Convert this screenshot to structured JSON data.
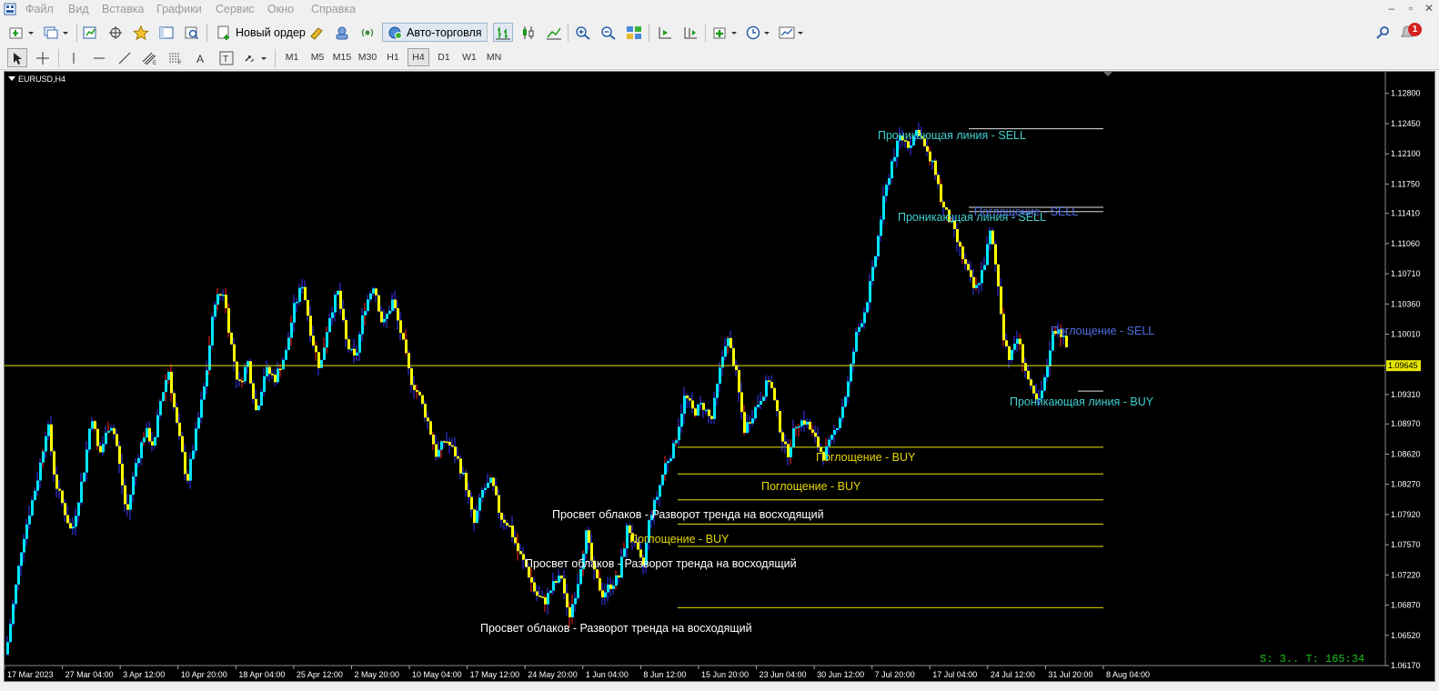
{
  "menu": {
    "items": [
      "Файл",
      "Вид",
      "Вставка",
      "Графики",
      "Сервис",
      "Окно",
      "Справка"
    ]
  },
  "toolbar": {
    "new_order_label": "Новый ордер",
    "auto_trading_label": "Авто-торговля",
    "notification_count": "1"
  },
  "timeframes": {
    "items": [
      "M1",
      "M5",
      "M15",
      "M30",
      "H1",
      "H4",
      "D1",
      "W1",
      "MN"
    ],
    "active": "H4"
  },
  "chart": {
    "symbol_label": "EURUSD,H4",
    "current_price_label": "1.09645",
    "timer_label": "S: 3.. T: 165:34"
  },
  "colors": {
    "background": "#000000",
    "bull_candle": "#00e5ff",
    "bear_candle": "#ffff00",
    "wick": "#3a3aff",
    "wick_red": "#ff2020",
    "price_line": "#e6e600",
    "buy_text": "#e6d800",
    "sell_text": "#40d0d0",
    "sell_text_alt": "#4f6fe0",
    "white_text": "#ffffff"
  },
  "chart_data": {
    "type": "candlestick",
    "y_ticks": [
      "1.12800",
      "1.12450",
      "1.12100",
      "1.11750",
      "1.11410",
      "1.11060",
      "1.10710",
      "1.10360",
      "1.10010",
      "1.09310",
      "1.08970",
      "1.08620",
      "1.08270",
      "1.07920",
      "1.07570",
      "1.07220",
      "1.06870",
      "1.06520",
      "1.06170"
    ],
    "y_tick_values": [
      1.128,
      1.1245,
      1.121,
      1.1175,
      1.1141,
      1.1106,
      1.1071,
      1.1036,
      1.1001,
      1.0931,
      1.0897,
      1.0862,
      1.0827,
      1.0792,
      1.0757,
      1.0722,
      1.0687,
      1.0652,
      1.0617
    ],
    "x_ticks": [
      "17 Mar 2023",
      "27 Mar 04:00",
      "3 Apr 12:00",
      "10 Apr 20:00",
      "18 Apr 04:00",
      "25 Apr 12:00",
      "2 May 20:00",
      "10 May 04:00",
      "17 May 12:00",
      "24 May 20:00",
      "1 Jun 04:00",
      "8 Jun 12:00",
      "15 Jun 20:00",
      "23 Jun 04:00",
      "30 Jun 12:00",
      "7 Jul 20:00",
      "17 Jul 04:00",
      "24 Jul 12:00",
      "31 Jul 20:00",
      "8 Aug 04:00"
    ],
    "ylim": [
      1.0617,
      1.1305
    ],
    "current_price": 1.09645,
    "close_path": [
      [
        0,
        1.063
      ],
      [
        0.015,
        1.076
      ],
      [
        0.03,
        1.084
      ],
      [
        0.038,
        1.09
      ],
      [
        0.045,
        1.083
      ],
      [
        0.055,
        1.079
      ],
      [
        0.06,
        1.077
      ],
      [
        0.072,
        1.085
      ],
      [
        0.078,
        1.091
      ],
      [
        0.085,
        1.086
      ],
      [
        0.095,
        1.09
      ],
      [
        0.1,
        1.088
      ],
      [
        0.11,
        1.079
      ],
      [
        0.118,
        1.085
      ],
      [
        0.127,
        1.089
      ],
      [
        0.135,
        1.087
      ],
      [
        0.14,
        1.092
      ],
      [
        0.148,
        1.096
      ],
      [
        0.155,
        1.09
      ],
      [
        0.165,
        1.083
      ],
      [
        0.175,
        1.09
      ],
      [
        0.182,
        1.095
      ],
      [
        0.19,
        1.104
      ],
      [
        0.198,
        1.105
      ],
      [
        0.205,
        1.099
      ],
      [
        0.212,
        1.094
      ],
      [
        0.22,
        1.097
      ],
      [
        0.228,
        1.091
      ],
      [
        0.236,
        1.096
      ],
      [
        0.245,
        1.095
      ],
      [
        0.255,
        1.098
      ],
      [
        0.262,
        1.103
      ],
      [
        0.27,
        1.106
      ],
      [
        0.278,
        1.1
      ],
      [
        0.286,
        1.096
      ],
      [
        0.294,
        1.102
      ],
      [
        0.302,
        1.105
      ],
      [
        0.31,
        1.099
      ],
      [
        0.318,
        1.097
      ],
      [
        0.326,
        1.103
      ],
      [
        0.335,
        1.106
      ],
      [
        0.343,
        1.101
      ],
      [
        0.352,
        1.104
      ],
      [
        0.36,
        1.1
      ],
      [
        0.368,
        1.095
      ],
      [
        0.376,
        1.093
      ],
      [
        0.384,
        1.09
      ],
      [
        0.392,
        1.086
      ],
      [
        0.4,
        1.088
      ],
      [
        0.41,
        1.086
      ],
      [
        0.418,
        1.083
      ],
      [
        0.426,
        1.078
      ],
      [
        0.434,
        1.082
      ],
      [
        0.442,
        1.083
      ],
      [
        0.45,
        1.079
      ],
      [
        0.458,
        1.078
      ],
      [
        0.466,
        1.075
      ],
      [
        0.474,
        1.073
      ],
      [
        0.482,
        1.07
      ],
      [
        0.49,
        1.069
      ],
      [
        0.498,
        1.071
      ],
      [
        0.506,
        1.072
      ],
      [
        0.512,
        1.067
      ],
      [
        0.52,
        1.071
      ],
      [
        0.528,
        1.077
      ],
      [
        0.536,
        1.072
      ],
      [
        0.543,
        1.07
      ],
      [
        0.55,
        1.071
      ],
      [
        0.558,
        1.072
      ],
      [
        0.566,
        1.078
      ],
      [
        0.574,
        1.075
      ],
      [
        0.58,
        1.073
      ],
      [
        0.586,
        1.079
      ],
      [
        0.592,
        1.081
      ],
      [
        0.6,
        1.085
      ],
      [
        0.608,
        1.087
      ],
      [
        0.618,
        1.093
      ],
      [
        0.626,
        1.091
      ],
      [
        0.634,
        1.092
      ],
      [
        0.642,
        1.09
      ],
      [
        0.65,
        1.096
      ],
      [
        0.656,
        1.1
      ],
      [
        0.664,
        1.096
      ],
      [
        0.672,
        1.089
      ],
      [
        0.68,
        1.091
      ],
      [
        0.688,
        1.093
      ],
      [
        0.695,
        1.095
      ],
      [
        0.703,
        1.09
      ],
      [
        0.711,
        1.086
      ],
      [
        0.72,
        1.09
      ],
      [
        0.728,
        1.09
      ],
      [
        0.736,
        1.088
      ],
      [
        0.744,
        1.086
      ],
      [
        0.752,
        1.088
      ],
      [
        0.76,
        1.091
      ],
      [
        0.766,
        1.094
      ],
      [
        0.774,
        1.1
      ],
      [
        0.782,
        1.103
      ],
      [
        0.79,
        1.108
      ],
      [
        0.798,
        1.115
      ],
      [
        0.806,
        1.12
      ],
      [
        0.814,
        1.123
      ],
      [
        0.822,
        1.122
      ],
      [
        0.83,
        1.124
      ],
      [
        0.838,
        1.121
      ],
      [
        0.846,
        1.119
      ],
      [
        0.852,
        1.115
      ],
      [
        0.86,
        1.113
      ],
      [
        0.868,
        1.11
      ],
      [
        0.876,
        1.107
      ],
      [
        0.882,
        1.105
      ],
      [
        0.89,
        1.108
      ],
      [
        0.896,
        1.112
      ],
      [
        0.902,
        1.107
      ],
      [
        0.908,
        1.1
      ],
      [
        0.914,
        1.097
      ],
      [
        0.92,
        1.1
      ],
      [
        0.928,
        1.096
      ],
      [
        0.934,
        1.093
      ],
      [
        0.94,
        1.092
      ],
      [
        0.946,
        1.095
      ],
      [
        0.952,
        1.1
      ],
      [
        0.958,
        1.101
      ],
      [
        0.964,
        1.099
      ],
      [
        0.97,
        1.097
      ]
    ],
    "levels": [
      {
        "price": 1.1239,
        "color": "#e0e0e0"
      },
      {
        "price": 1.1148,
        "color": "#e0e0e0"
      },
      {
        "price": 1.1143,
        "color": "#e0e0e0"
      },
      {
        "price": 1.0935,
        "color": "#e0e0e0"
      },
      {
        "price": 1.087,
        "color": "#e6e600"
      },
      {
        "price": 1.0839,
        "color": "#e6e600"
      },
      {
        "price": 1.0809,
        "color": "#e6e600"
      },
      {
        "price": 1.0781,
        "color": "#e6e600"
      },
      {
        "price": 1.0755,
        "color": "#e6e600"
      },
      {
        "price": 1.0684,
        "color": "#e6e600"
      }
    ],
    "pattern_labels": [
      {
        "text": "Проникающая линия - SELL",
        "color": "#40d0d0"
      },
      {
        "text": "Проникающая линия - SELL",
        "color": "#40d0d0"
      },
      {
        "text": "Поглощение - SELL",
        "color": "#4f6fe0"
      },
      {
        "text": "Поглощение - SELL",
        "color": "#4f6fe0"
      },
      {
        "text": "Проникающая линия - BUY",
        "color": "#40d0d0"
      },
      {
        "text": "Поглощение - BUY",
        "color": "#e6d800"
      },
      {
        "text": "Поглощение - BUY",
        "color": "#e6d800"
      },
      {
        "text": "Просвет облаков - Разворот тренда на восходящий",
        "color": "#ffffff"
      },
      {
        "text": "Поглощение - BUY",
        "color": "#e6d800"
      },
      {
        "text": "Просвет облаков - Разворот тренда на восходящий",
        "color": "#ffffff"
      },
      {
        "text": "Просвет облаков - Разворот тренда на восходящий",
        "color": "#ffffff"
      }
    ]
  }
}
